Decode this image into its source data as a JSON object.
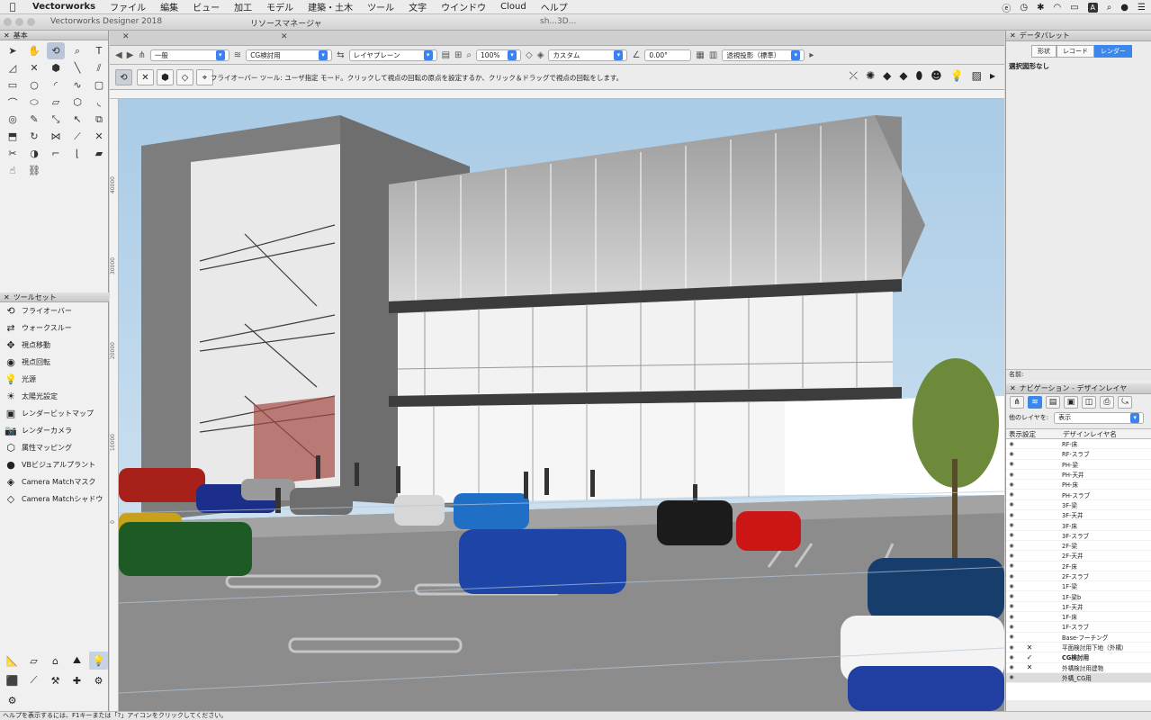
{
  "menubar": {
    "app_name": "Vectorworks",
    "items": [
      "ファイル",
      "編集",
      "ビュー",
      "加工",
      "モデル",
      "建築・土木",
      "ツール",
      "文字",
      "ウインドウ",
      "Cloud",
      "ヘルプ"
    ],
    "status_letter": "A"
  },
  "window": {
    "title": "Vectorworks Designer 2018",
    "resource_manager_title": "リソースマネージャ",
    "document_title": "sh...3D..."
  },
  "left_palette": {
    "basic_title": "基本",
    "toolset_title": "ツールセット",
    "toolset_items": [
      {
        "label": "フライオーバー",
        "icon": "flyover-icon",
        "glyph": "⟲"
      },
      {
        "label": "ウォークスルー",
        "icon": "walkthrough-icon",
        "glyph": "⇄"
      },
      {
        "label": "視点移動",
        "icon": "translate-view-icon",
        "glyph": "✥"
      },
      {
        "label": "視点回転",
        "icon": "rotate-view-icon",
        "glyph": "◉"
      },
      {
        "label": "光源",
        "icon": "light-icon",
        "glyph": "💡"
      },
      {
        "label": "太陽光設定",
        "icon": "sun-icon",
        "glyph": "☀"
      },
      {
        "label": "レンダービットマップ",
        "icon": "render-bitmap-icon",
        "glyph": "▣"
      },
      {
        "label": "レンダーカメラ",
        "icon": "render-camera-icon",
        "glyph": "📷"
      },
      {
        "label": "属性マッピング",
        "icon": "attribute-mapping-icon",
        "glyph": "⬡"
      },
      {
        "label": "VBビジュアルプラント",
        "icon": "visual-plant-icon",
        "glyph": "●"
      },
      {
        "label": "Camera Matchマスク",
        "icon": "camera-match-mask-icon",
        "glyph": "◈"
      },
      {
        "label": "Camera Matchシャドウ",
        "icon": "camera-match-shadow-icon",
        "glyph": "◇"
      }
    ]
  },
  "viewbar": {
    "class_value": "一般",
    "layer_value": "CG検討用",
    "layer_plane": "レイヤプレーン",
    "zoom": "100%",
    "render_mode": "カスタム",
    "angle": "0.00°",
    "projection": "透視投影（標準）"
  },
  "modebar": {
    "message": "フライオーバー ツール: ユーザ指定 モード。クリックして視点の回転の原点を設定するか、クリック＆ドラッグで視点の回転をします。"
  },
  "rulers": {
    "left_labels": [
      "40000",
      "30000",
      "20000",
      "10000",
      "0"
    ]
  },
  "data_palette": {
    "title": "データパレット",
    "tabs": [
      "形状",
      "レコード",
      "レンダー"
    ],
    "selected_tab": "レンダー",
    "selection_text": "選択図形なし",
    "name_label": "名前:"
  },
  "navigation": {
    "title": "ナビゲーション - デザインレイヤ",
    "other_layers_label": "他のレイヤを:",
    "other_layers_value": "表示",
    "col_visibility": "表示設定",
    "col_layer_name": "デザインレイヤ名",
    "layers": [
      {
        "name": "RF-床",
        "vis": ""
      },
      {
        "name": "RF-スラブ",
        "vis": ""
      },
      {
        "name": "PH-梁",
        "vis": ""
      },
      {
        "name": "PH-天井",
        "vis": ""
      },
      {
        "name": "PH-床",
        "vis": ""
      },
      {
        "name": "PH-スラブ",
        "vis": ""
      },
      {
        "name": "3F-梁",
        "vis": ""
      },
      {
        "name": "3F-天井",
        "vis": ""
      },
      {
        "name": "3F-床",
        "vis": ""
      },
      {
        "name": "3F-スラブ",
        "vis": ""
      },
      {
        "name": "2F-梁",
        "vis": ""
      },
      {
        "name": "2F-天井",
        "vis": ""
      },
      {
        "name": "2F-床",
        "vis": ""
      },
      {
        "name": "2F-スラブ",
        "vis": ""
      },
      {
        "name": "1F-梁",
        "vis": ""
      },
      {
        "name": "1F-梁b",
        "vis": ""
      },
      {
        "name": "1F-天井",
        "vis": ""
      },
      {
        "name": "1F-床",
        "vis": ""
      },
      {
        "name": "1F-スラブ",
        "vis": ""
      },
      {
        "name": "Base-フーチング",
        "vis": ""
      },
      {
        "name": "平面検討用下地（外構）",
        "vis": "✕"
      },
      {
        "name": "CG検討用",
        "vis": "✓",
        "active": true
      },
      {
        "name": "外構検討用建物",
        "vis": "✕"
      },
      {
        "name": "外構_CG用",
        "vis": "",
        "highlight": true
      }
    ]
  },
  "statusbar": {
    "text": "ヘルプを表示するには、F1キーまたは「?」アイコンをクリックしてください。"
  },
  "colors": {
    "accent": "#3c87ec",
    "sky": "#bcd7ec",
    "ground": "#8a8a8a"
  }
}
